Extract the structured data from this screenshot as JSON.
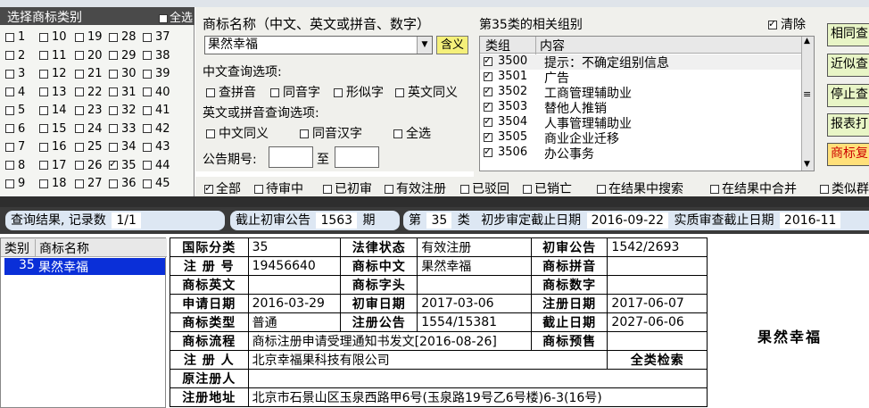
{
  "category_panel": {
    "title": "选择商标类别",
    "select_all": "全选",
    "checked": [
      "35"
    ],
    "columns": [
      [
        "1",
        "2",
        "3",
        "4",
        "5",
        "6",
        "7",
        "8",
        "9"
      ],
      [
        "10",
        "11",
        "12",
        "13",
        "14",
        "15",
        "16",
        "17",
        "18"
      ],
      [
        "19",
        "20",
        "21",
        "22",
        "23",
        "24",
        "25",
        "26",
        "27"
      ],
      [
        "28",
        "29",
        "30",
        "31",
        "32",
        "33",
        "34",
        "35",
        "36"
      ],
      [
        "37",
        "38",
        "39",
        "40",
        "41",
        "42",
        "43",
        "44",
        "45"
      ]
    ]
  },
  "search": {
    "name_label": "商标名称（中文、英文或拼音、数字）",
    "name_value": "果然幸福",
    "meaning_button": "含义",
    "cn_options_label": "中文查询选项:",
    "cn_options": [
      "查拼音",
      "同音字",
      "形似字",
      "英文同义"
    ],
    "en_options_label": "英文或拼音查询选项:",
    "en_options": [
      "中文同义",
      "同音汉字",
      "全选"
    ],
    "issue_label": "公告期号:",
    "to_label": "至"
  },
  "groups": {
    "title": "第35类的相关组别",
    "clear_label": "清除",
    "clear_checked": true,
    "col_group": "类组",
    "col_content": "内容",
    "rows": [
      {
        "code": "3500",
        "text": "提示：不确定组别信息"
      },
      {
        "code": "3501",
        "text": "广告"
      },
      {
        "code": "3502",
        "text": "工商管理辅助业"
      },
      {
        "code": "3503",
        "text": "替他人推销"
      },
      {
        "code": "3504",
        "text": "人事管理辅助业"
      },
      {
        "code": "3505",
        "text": "商业企业迁移"
      },
      {
        "code": "3506",
        "text": "办公事务"
      }
    ]
  },
  "right_buttons": [
    "相同查",
    "近似查",
    "停止查",
    "报表打",
    "商标复"
  ],
  "filters": [
    "全部",
    "待审中",
    "已初审",
    "有效注册",
    "已驳回",
    "已销亡",
    "在结果中搜索",
    "在结果中合并",
    "类似群"
  ],
  "status": {
    "result_label": "查询结果, 记录数",
    "result_count": "1/1",
    "cutoff_label": "截止初审公告",
    "cutoff_value": "1563",
    "cutoff_unit": "期",
    "class_prefix": "第",
    "class_value": "35",
    "class_suffix": "类",
    "prelim_label": "初步审定截止日期",
    "prelim_date": "2016-09-22",
    "exam_label": "实质审查截止日期",
    "exam_date": "2016-11"
  },
  "results": {
    "col_class": "类别",
    "col_name": "商标名称",
    "row": {
      "class": "35",
      "name": "果然幸福"
    }
  },
  "detail": {
    "intl_class_label": "国际分类",
    "intl_class": "35",
    "legal_status_label": "法律状态",
    "legal_status": "有效注册",
    "prelim_label": "初审公告",
    "prelim": "1542/2693",
    "reg_no_label": "注 册 号",
    "reg_no": "19456640",
    "cn_name_label": "商标中文",
    "cn_name": "果然幸福",
    "pinyin_label": "商标拼音",
    "pinyin": "",
    "en_name_label": "商标英文",
    "en_name": "",
    "head_label": "商标字头",
    "head": "",
    "digits_label": "商标数字",
    "digits": "",
    "apply_date_label": "申请日期",
    "apply_date": "2016-03-29",
    "prelim_date_label": "初审日期",
    "prelim_date": "2017-03-06",
    "reg_date_label": "注册日期",
    "reg_date": "2017-06-07",
    "type_label": "商标类型",
    "type": "普通",
    "reg_notice_label": "注册公告",
    "reg_notice": "1554/15381",
    "expire_label": "截止日期",
    "expire": "2027-06-06",
    "flow_label": "商标流程",
    "flow": "商标注册申请受理通知书发文[2016-08-26]",
    "forecast_label": "商标预售",
    "forecast": "",
    "registrant_label": "注 册 人",
    "registrant": "北京幸福果科技有限公司",
    "all_class_search": "全类检索",
    "orig_registrant_label": "原注册人",
    "orig_registrant": "",
    "address_label": "注册地址",
    "address": "北京市石景山区玉泉西路甲6号(玉泉路19号乙6号楼)6-3(16号)"
  },
  "preview": {
    "name": "果然幸福"
  }
}
